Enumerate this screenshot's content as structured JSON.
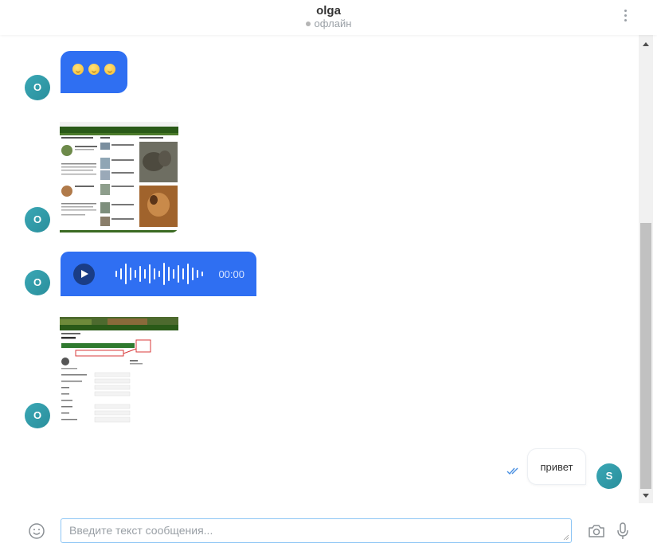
{
  "header": {
    "contact_name": "olga",
    "status": "офлайн"
  },
  "messages": [
    {
      "type": "emoji",
      "sender_initial": "O",
      "emojis": [
        "grin-emoji",
        "grin-emoji",
        "grin-emoji"
      ]
    },
    {
      "type": "image",
      "sender_initial": "O",
      "description": "website-screenshot"
    },
    {
      "type": "voice",
      "sender_initial": "O",
      "duration": "00:00"
    },
    {
      "type": "image",
      "sender_initial": "O",
      "description": "website-screenshot"
    },
    {
      "type": "text",
      "sender_initial": "S",
      "text": "привет",
      "status": "read"
    }
  ],
  "composer": {
    "placeholder": "Введите текст сообщения..."
  },
  "colors": {
    "incoming_bubble": "#2f6ff2",
    "avatar": "#3aa7b5",
    "input_border": "#8ec6f5",
    "read_check": "#4a90e2"
  }
}
